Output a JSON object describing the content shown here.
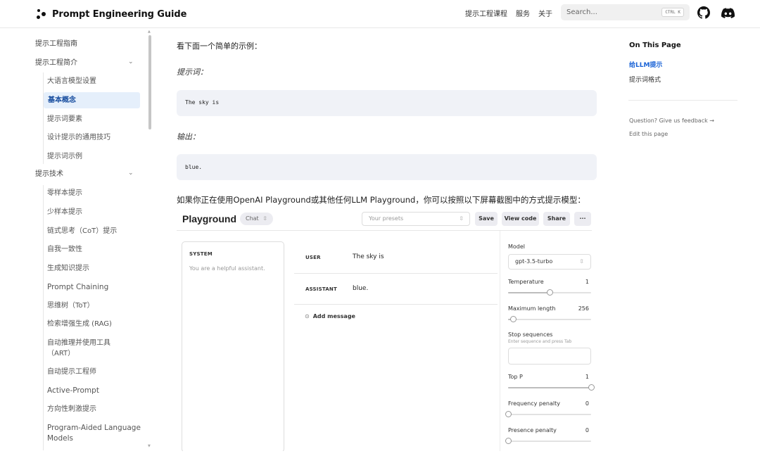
{
  "site": {
    "title": "Prompt Engineering Guide",
    "nav": [
      "提示工程课程",
      "服务",
      "关于"
    ],
    "search_placeholder": "Search...",
    "search_shortcut": "CTRL K",
    "icons": {
      "github": "github-icon",
      "discord": "discord-icon"
    }
  },
  "sidebar": {
    "items": [
      {
        "label": "提示工程指南",
        "level": 0
      },
      {
        "label": "提示工程简介",
        "level": 0,
        "expanded": true
      },
      {
        "label": "大语言模型设置",
        "level": 1
      },
      {
        "label": "基本概念",
        "level": 1,
        "active": true
      },
      {
        "label": "提示词要素",
        "level": 1
      },
      {
        "label": "设计提示的通用技巧",
        "level": 1
      },
      {
        "label": "提示词示例",
        "level": 1
      },
      {
        "label": "提示技术",
        "level": 0,
        "expanded": true
      },
      {
        "label": "零样本提示",
        "level": 1
      },
      {
        "label": "少样本提示",
        "level": 1
      },
      {
        "label": "链式思考（CoT）提示",
        "level": 1
      },
      {
        "label": "自我一致性",
        "level": 1
      },
      {
        "label": "生成知识提示",
        "level": 1
      },
      {
        "label": "Prompt Chaining",
        "level": 1
      },
      {
        "label": "思维树（ToT）",
        "level": 1
      },
      {
        "label": "检索增强生成 (RAG)",
        "level": 1
      },
      {
        "label": "自动推理并使用工具",
        "label2": "（ART）",
        "level": 1
      },
      {
        "label": "自动提示工程师",
        "level": 1
      },
      {
        "label": "Active-Prompt",
        "level": 1
      },
      {
        "label": "方向性刺激提示",
        "level": 1
      },
      {
        "label": "Program-Aided Language",
        "label2": "Models",
        "level": 1
      }
    ]
  },
  "main": {
    "intro": "看下面一个简单的示例：",
    "prompt_label": "提示词：",
    "prompt_code": "The sky is",
    "output_label": "输出：",
    "output_code": "blue.",
    "playground_intro": "如果你正在使用OpenAI Playground或其他任何LLM Playground，你可以按照以下屏幕截图中的方式提示模型："
  },
  "playground": {
    "title": "Playground",
    "mode": "Chat",
    "presets_placeholder": "Your presets",
    "buttons": {
      "save": "Save",
      "view_code": "View code",
      "share": "Share",
      "more": "···"
    },
    "system_label": "SYSTEM",
    "system_text": "You are a helpful assistant.",
    "messages": [
      {
        "role": "USER",
        "text": "The sky is"
      },
      {
        "role": "ASSISTANT",
        "text": "blue."
      }
    ],
    "add_message": "Add message",
    "params": {
      "model_label": "Model",
      "model": "gpt-3.5-turbo",
      "temperature_label": "Temperature",
      "temperature": "1",
      "temperature_level": 0.5,
      "max_length_label": "Maximum length",
      "max_length": "256",
      "max_length_level": 0.06,
      "stop_label": "Stop sequences",
      "stop_hint": "Enter sequence and press Tab",
      "top_p_label": "Top P",
      "top_p": "1",
      "top_p_level": 1.0,
      "freq_label": "Frequency penalty",
      "freq": "0",
      "freq_level": 0.0,
      "presence_label": "Presence penalty",
      "presence": "0",
      "presence_level": 0.0
    }
  },
  "toc": {
    "title": "On This Page",
    "links": [
      "给LLM提示",
      "提示词格式"
    ],
    "feedback": "Question? Give us feedback →",
    "edit": "Edit this page"
  },
  "colors": {
    "active_bg": "#e5effb",
    "active_text": "#1a4fa0",
    "toc_active": "#1a63d6",
    "code_bg": "#f0f2f7"
  }
}
